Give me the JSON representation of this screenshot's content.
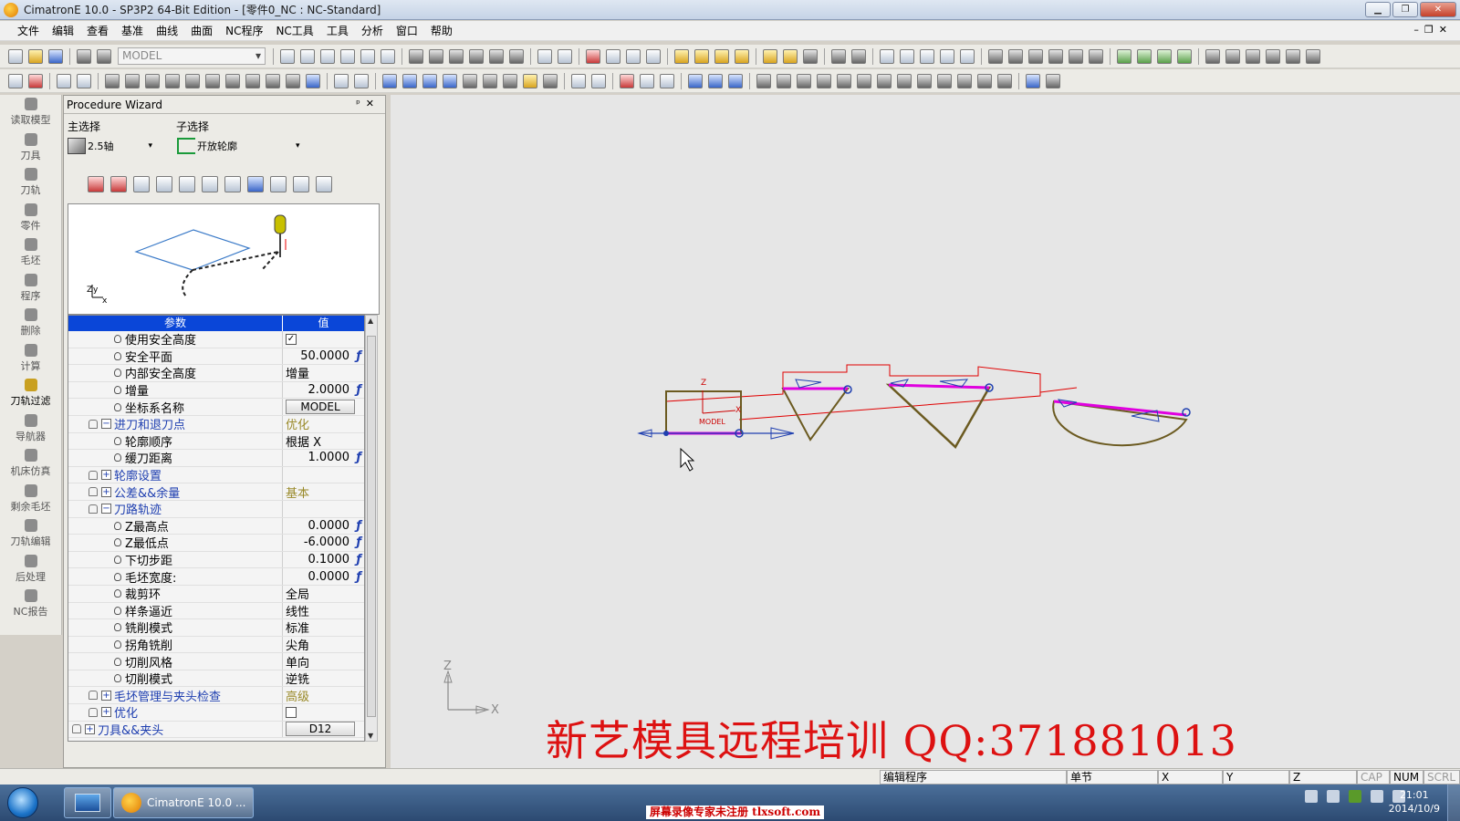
{
  "window": {
    "title": "CimatronE 10.0 - SP3P2 64-Bit Edition - [零件0_NC : NC-Standard]"
  },
  "menu": [
    "文件",
    "编辑",
    "查看",
    "基准",
    "曲线",
    "曲面",
    "NC程序",
    "NC工具",
    "工具",
    "分析",
    "窗口",
    "帮助"
  ],
  "toolbar": {
    "model_dropdown": "MODEL"
  },
  "leftnav": [
    "读取模型",
    "刀具",
    "刀轨",
    "零件",
    "毛坯",
    "程序",
    "删除",
    "计算",
    "刀轨过滤",
    "导航器",
    "机床仿真",
    "剩余毛坯",
    "刀轨编辑",
    "后处理",
    "NC报告"
  ],
  "panel": {
    "title": "Procedure Wizard",
    "main_label": "主选择",
    "sub_label": "子选择",
    "main_value": "2.5轴",
    "sub_value": "开放轮廓",
    "axis_z": "Z",
    "axis_y": "y",
    "axis_x": "x"
  },
  "grid": {
    "col_param": "参数",
    "col_value": "值",
    "rows": [
      {
        "name": "使用安全高度",
        "value": "✓"
      },
      {
        "name": "安全平面",
        "value": "50.0000"
      },
      {
        "name": "内部安全高度",
        "value": "增量"
      },
      {
        "name": "增量",
        "value": "2.0000"
      },
      {
        "name": "坐标系名称",
        "value": "MODEL"
      },
      {
        "name": "进刀和退刀点",
        "value": "优化"
      },
      {
        "name": "轮廓顺序",
        "value": "根据 X"
      },
      {
        "name": "缓刀距离",
        "value": "1.0000"
      },
      {
        "name": "轮廓设置",
        "value": ""
      },
      {
        "name": "公差&&余量",
        "value": "基本"
      },
      {
        "name": "刀路轨迹",
        "value": ""
      },
      {
        "name": "Z最高点",
        "value": "0.0000"
      },
      {
        "name": "Z最低点",
        "value": "-6.0000"
      },
      {
        "name": "下切步距",
        "value": "0.1000"
      },
      {
        "name": "毛坯宽度:",
        "value": "0.0000"
      },
      {
        "name": "裁剪环",
        "value": "全局"
      },
      {
        "name": "样条逼近",
        "value": "线性"
      },
      {
        "name": "铣削模式",
        "value": "标准"
      },
      {
        "name": "拐角铣削",
        "value": "尖角"
      },
      {
        "name": "切削风格",
        "value": "单向"
      },
      {
        "name": "切削模式",
        "value": "逆铣"
      },
      {
        "name": "毛坯管理与夹头检查",
        "value": "高级"
      },
      {
        "name": "优化",
        "value": ""
      },
      {
        "name": "刀具&&夹头",
        "value": "D12"
      }
    ]
  },
  "viewport": {
    "model_label": "MODEL",
    "z_marker": "Z",
    "x_marker": "X",
    "axis_z": "Z",
    "axis_x": "X",
    "banner": "新艺模具远程培训 QQ:371881013"
  },
  "statusbar": {
    "prompt": "编辑程序",
    "mode": "单节",
    "x": "X",
    "y": "Y",
    "z": "Z",
    "cap": "CAP",
    "num": "NUM",
    "scrl": "SCRL"
  },
  "taskbar": {
    "app": "CimatronE 10.0 ...",
    "time": "21:01",
    "date": "2014/10/9"
  },
  "watermark": "屏幕录像专家未注册 tlxsoft.com",
  "colors": {
    "toolpath": "#e000e0",
    "rapid": "#e00000",
    "geometry": "#6b5a20",
    "selection": "#0a46d8"
  }
}
